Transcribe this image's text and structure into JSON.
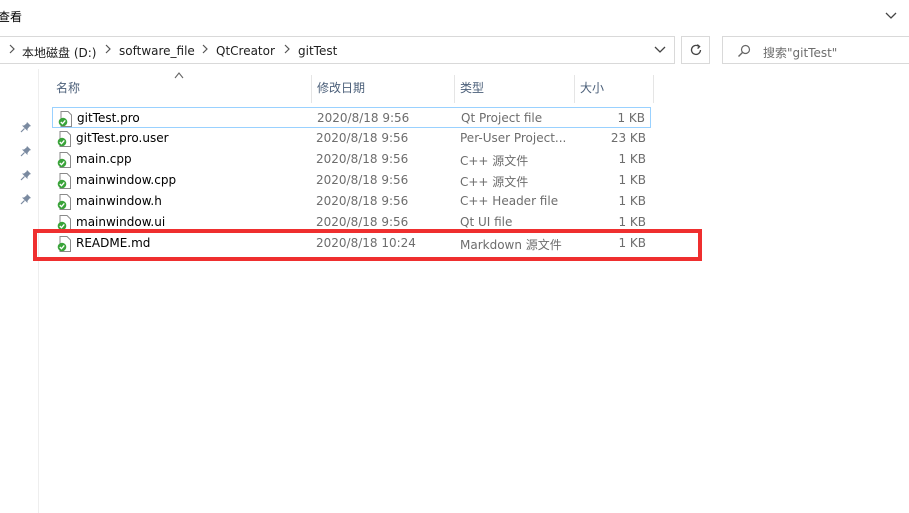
{
  "menu": {
    "view_tab": "查看"
  },
  "address": {
    "breadcrumbs": [
      "本地磁盘 (D:)",
      "software_file",
      "QtCreator",
      "gitTest"
    ]
  },
  "search": {
    "placeholder": "搜索\"gitTest\""
  },
  "columns": {
    "name": "名称",
    "modified": "修改日期",
    "type": "类型",
    "size": "大小"
  },
  "files": [
    {
      "name": "gitTest.pro",
      "modified": "2020/8/18 9:56",
      "type": "Qt Project file",
      "size": "1 KB"
    },
    {
      "name": "gitTest.pro.user",
      "modified": "2020/8/18 9:56",
      "type": "Per-User Project...",
      "size": "23 KB"
    },
    {
      "name": "main.cpp",
      "modified": "2020/8/18 9:56",
      "type": "C++ 源文件",
      "size": "1 KB"
    },
    {
      "name": "mainwindow.cpp",
      "modified": "2020/8/18 9:56",
      "type": "C++ 源文件",
      "size": "1 KB"
    },
    {
      "name": "mainwindow.h",
      "modified": "2020/8/18 9:56",
      "type": "C++ Header file",
      "size": "1 KB"
    },
    {
      "name": "mainwindow.ui",
      "modified": "2020/8/18 9:56",
      "type": "Qt UI file",
      "size": "1 KB"
    },
    {
      "name": "README.md",
      "modified": "2020/8/18 10:24",
      "type": "Markdown 源文件",
      "size": "1 KB"
    }
  ],
  "colors": {
    "highlight": "#ef2f2f",
    "focus": "#99d1ff",
    "header_text": "#4c607a",
    "sync_badge": "#3aa33a"
  },
  "icons": [
    "chevron-down-icon",
    "chevron-right-icon",
    "refresh-icon",
    "search-icon",
    "pin-icon",
    "file-synced-icon"
  ]
}
